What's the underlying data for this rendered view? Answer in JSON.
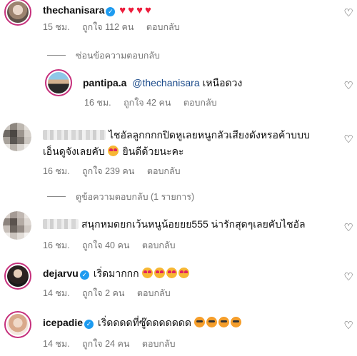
{
  "comments": [
    {
      "username": "thechanisara",
      "text": "",
      "hearts": "♥♥♥♥",
      "time": "15 ชม.",
      "likes": "ถูกใจ 112 คน",
      "reply": "ตอบกลับ",
      "toggle_replies": "ซ่อนข้อความตอบกลับ"
    },
    {
      "username": "pantipa.a",
      "mention": "@thechanisara",
      "text": "เหนือดวง",
      "time": "16 ชม.",
      "likes": "ถูกใจ 42 คน",
      "reply": "ตอบกลับ"
    },
    {
      "username": "",
      "text_line1": "ไชอัลลูกกกกปิดหูเลยหนูกลัวเสียงดังหรอค้าบบบ",
      "text_line2": "เอ็นดูจังเลยคับ",
      "text_line2b": "ยินดีด้วยนะคะ",
      "time": "16 ชม.",
      "likes": "ถูกใจ 239 คน",
      "reply": "ตอบกลับ",
      "toggle_replies": "ดูข้อความตอบกลับ (1 รายการ)"
    },
    {
      "username": "",
      "text": "สนุกหมดยกเว้นหนูน้อยยย555 น่ารักสุดๆเลยคับไชอัล",
      "time": "16 ชม.",
      "likes": "ถูกใจ 40 คน",
      "reply": "ตอบกลับ"
    },
    {
      "username": "dejarvu",
      "text": "เริ่ดมากกก",
      "time": "14 ชม.",
      "likes": "ถูกใจ 2 คน",
      "reply": "ตอบกลับ"
    },
    {
      "username": "icepadie",
      "text": "เริ่ดดดดที่ซู๊ดดดดดดด",
      "time": "14 ชม.",
      "likes": "ถูกใจ 24 คน",
      "reply": "ตอบกลับ"
    }
  ],
  "icons": {
    "verified": "verified-badge-icon",
    "like": "heart-outline-icon",
    "emoji_love": "heart-eyes-emoji",
    "emoji_party": "partying-face-emoji"
  },
  "colors": {
    "heart_red": "#ed1c3b",
    "verified_blue": "#1d9bf0",
    "meta_gray": "#737373",
    "mention_blue": "#1a4a8a"
  },
  "glyphs": {
    "check": "✓",
    "like": "♡"
  }
}
